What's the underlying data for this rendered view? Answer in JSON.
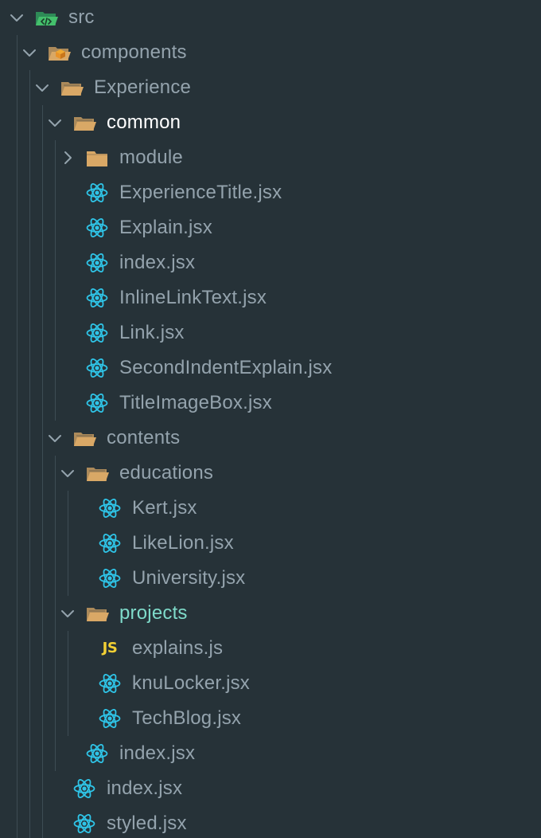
{
  "colors": {
    "background": "#263238",
    "text": "#94a3ad",
    "text_active": "#ffffff",
    "text_highlight": "#7fdbca",
    "folder": "#d9a866",
    "react": "#2fc5e8",
    "javascript": "#f2d034",
    "guide": "#3d4c54"
  },
  "explorer": {
    "items": [
      {
        "name": "src",
        "kind": "folder",
        "icon": "src-folder-icon",
        "depth": 0,
        "expanded": true
      },
      {
        "name": "components",
        "kind": "folder",
        "icon": "components-folder-icon",
        "depth": 1,
        "expanded": true
      },
      {
        "name": "Experience",
        "kind": "folder",
        "icon": "folder-open-icon",
        "depth": 2,
        "expanded": true
      },
      {
        "name": "common",
        "kind": "folder",
        "icon": "folder-open-icon",
        "depth": 3,
        "expanded": true,
        "style": "active"
      },
      {
        "name": "module",
        "kind": "folder",
        "icon": "folder-closed-icon",
        "depth": 4,
        "expanded": false
      },
      {
        "name": "ExperienceTitle.jsx",
        "kind": "file",
        "icon": "react-icon",
        "depth": 4
      },
      {
        "name": "Explain.jsx",
        "kind": "file",
        "icon": "react-icon",
        "depth": 4
      },
      {
        "name": "index.jsx",
        "kind": "file",
        "icon": "react-icon",
        "depth": 4
      },
      {
        "name": "InlineLinkText.jsx",
        "kind": "file",
        "icon": "react-icon",
        "depth": 4
      },
      {
        "name": "Link.jsx",
        "kind": "file",
        "icon": "react-icon",
        "depth": 4
      },
      {
        "name": "SecondIndentExplain.jsx",
        "kind": "file",
        "icon": "react-icon",
        "depth": 4
      },
      {
        "name": "TitleImageBox.jsx",
        "kind": "file",
        "icon": "react-icon",
        "depth": 4
      },
      {
        "name": "contents",
        "kind": "folder",
        "icon": "folder-open-icon",
        "depth": 3,
        "expanded": true
      },
      {
        "name": "educations",
        "kind": "folder",
        "icon": "folder-open-icon",
        "depth": 4,
        "expanded": true
      },
      {
        "name": "Kert.jsx",
        "kind": "file",
        "icon": "react-icon",
        "depth": 5
      },
      {
        "name": "LikeLion.jsx",
        "kind": "file",
        "icon": "react-icon",
        "depth": 5
      },
      {
        "name": "University.jsx",
        "kind": "file",
        "icon": "react-icon",
        "depth": 5
      },
      {
        "name": "projects",
        "kind": "folder",
        "icon": "folder-open-icon",
        "depth": 4,
        "expanded": true,
        "style": "highlight"
      },
      {
        "name": "explains.js",
        "kind": "file",
        "icon": "javascript-icon",
        "depth": 5,
        "icon_text": "JS"
      },
      {
        "name": "knuLocker.jsx",
        "kind": "file",
        "icon": "react-icon",
        "depth": 5
      },
      {
        "name": "TechBlog.jsx",
        "kind": "file",
        "icon": "react-icon",
        "depth": 5
      },
      {
        "name": "index.jsx",
        "kind": "file",
        "icon": "react-icon",
        "depth": 4
      },
      {
        "name": "index.jsx",
        "kind": "file",
        "icon": "react-icon",
        "depth": 3
      },
      {
        "name": "styled.jsx",
        "kind": "file",
        "icon": "react-icon",
        "depth": 3
      }
    ]
  }
}
